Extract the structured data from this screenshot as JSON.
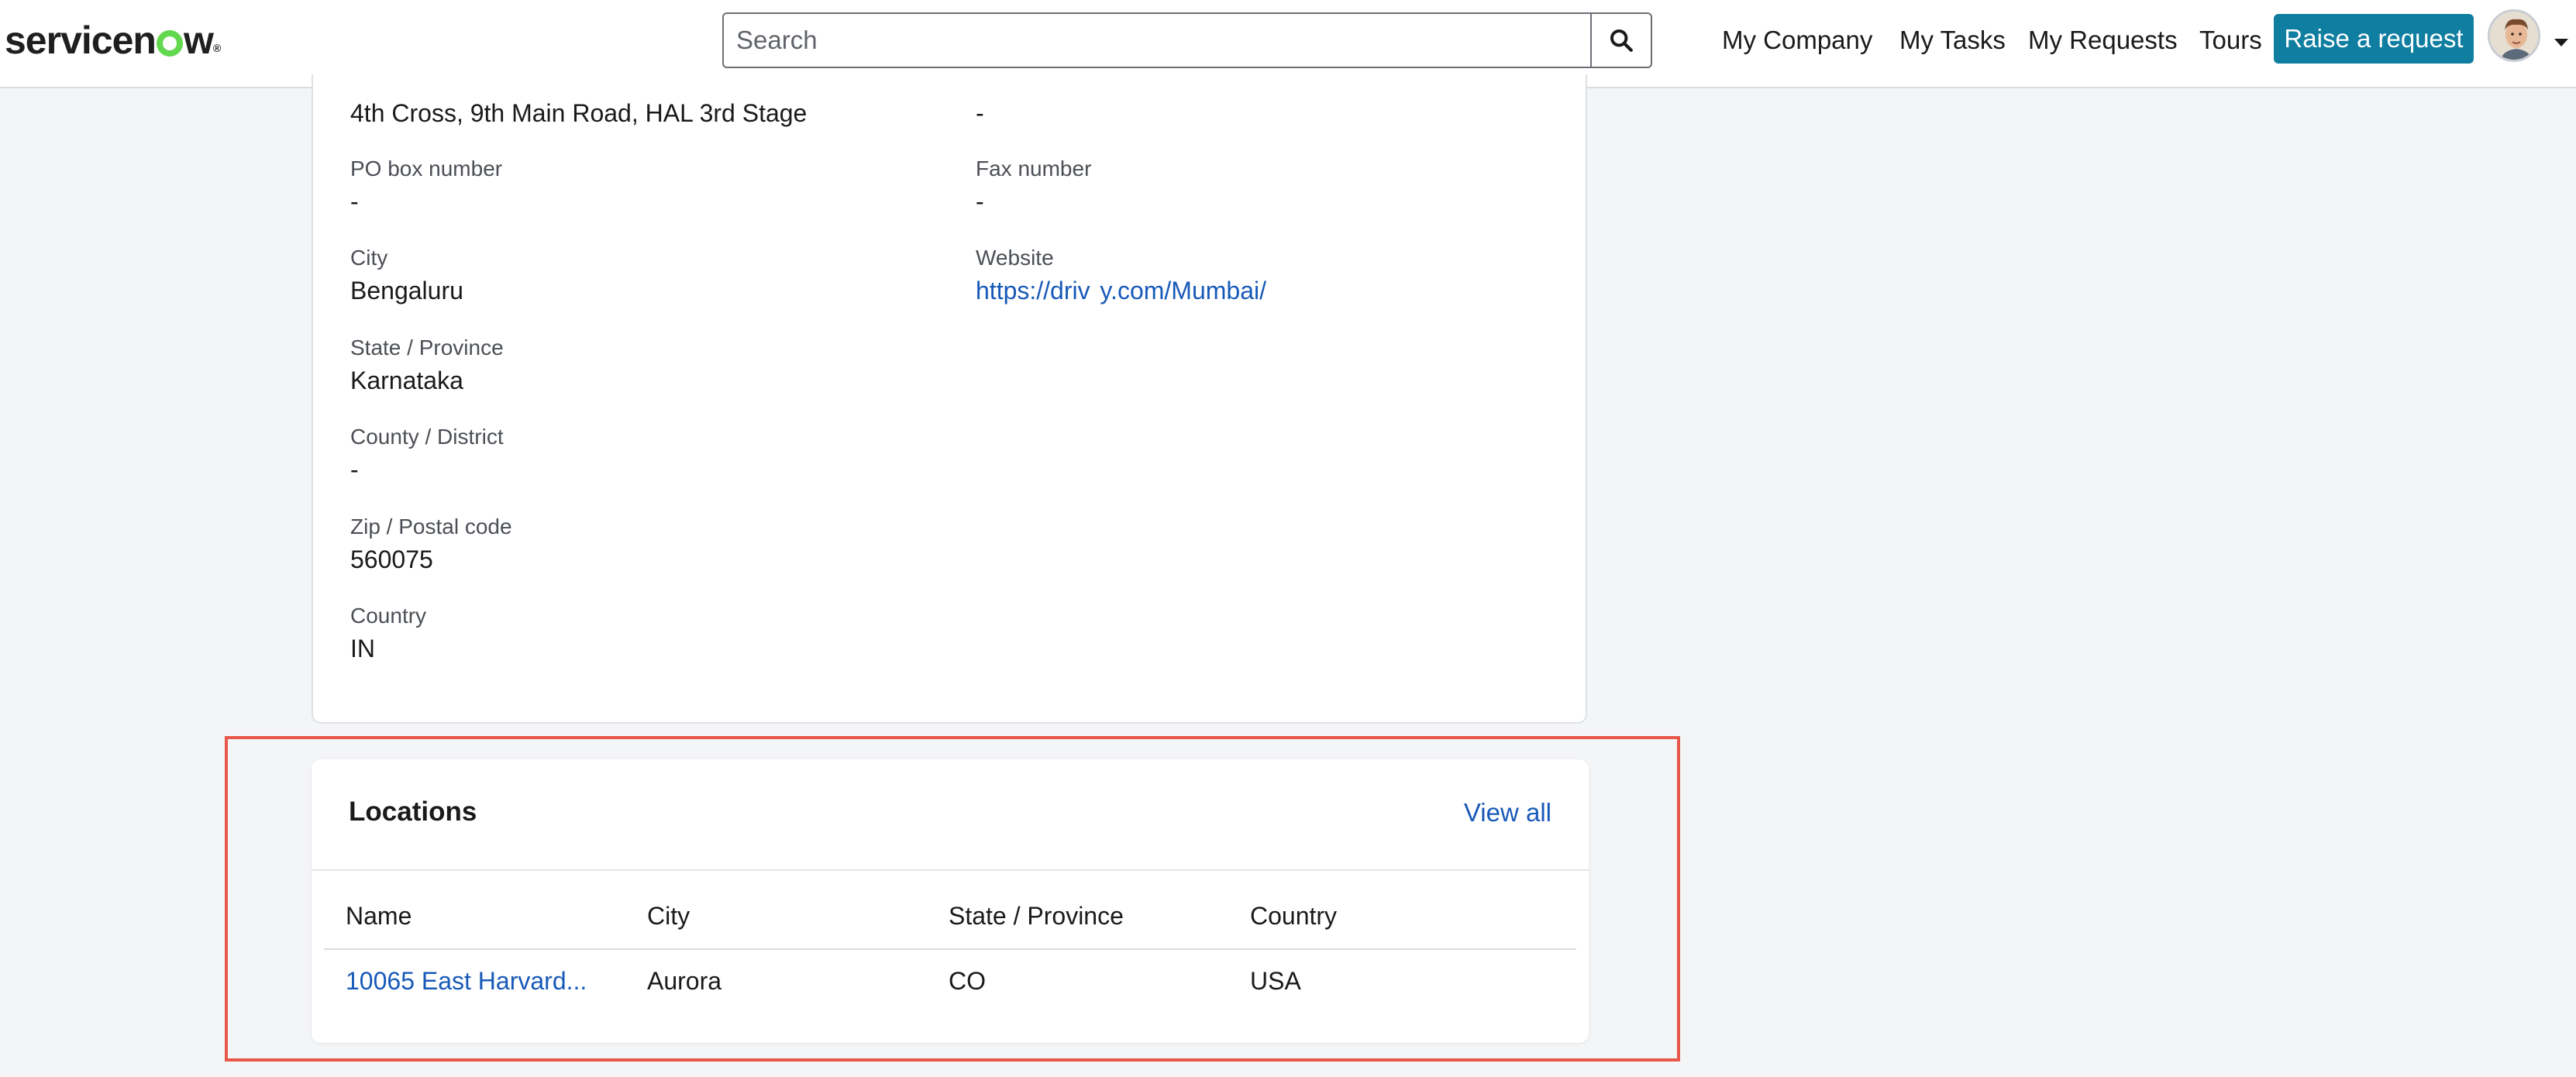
{
  "header": {
    "logo_text": "servicenow",
    "search": {
      "placeholder": "Search",
      "value": ""
    },
    "nav": [
      "My Company",
      "My Tasks",
      "My Requests",
      "Tours"
    ],
    "raise_request_label": "Raise a request",
    "brand_color": "#0f7ea0",
    "icons": [
      "search-icon",
      "avatar",
      "chevron-down-icon"
    ]
  },
  "details": {
    "street_value": "4th Cross, 9th Main Road, HAL 3rd Stage",
    "right_top_value": "-",
    "po_box_label": "PO box number",
    "po_box_value": "-",
    "fax_label": "Fax number",
    "fax_value": "-",
    "city_label": "City",
    "city_value": "Bengaluru",
    "website_label": "Website",
    "website_value": "https://driv  y.com/Mumbai/",
    "state_label": "State / Province",
    "state_value": "Karnataka",
    "county_label": "County / District",
    "county_value": "-",
    "zip_label": "Zip / Postal code",
    "zip_value": "560075",
    "country_label": "Country",
    "country_value": "IN"
  },
  "locations": {
    "title": "Locations",
    "view_all": "View all",
    "columns": [
      "Name",
      "City",
      "State / Province",
      "Country"
    ],
    "rows": [
      {
        "name": "10065 East Harvard...",
        "city": "Aurora",
        "state": "CO",
        "country": "USA"
      }
    ],
    "highlight_color": "#e8574a"
  }
}
